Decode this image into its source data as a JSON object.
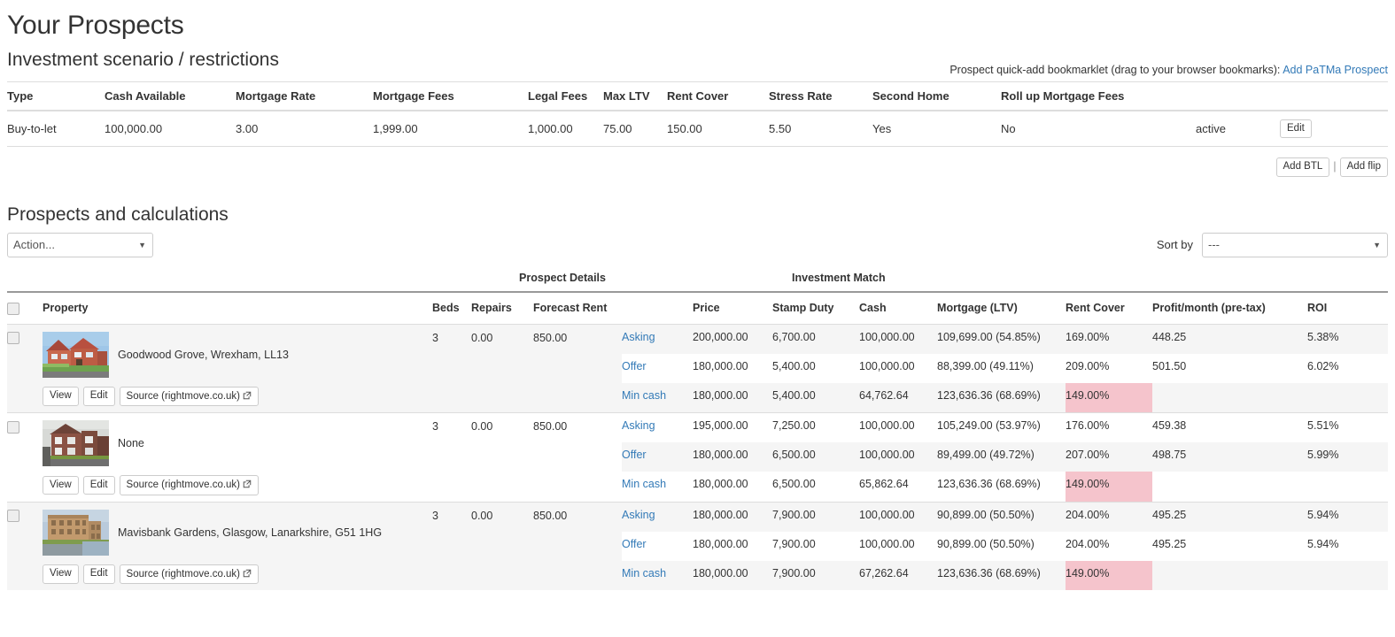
{
  "page": {
    "title": "Your Prospects",
    "scenario_heading": "Investment scenario / restrictions",
    "prospects_heading": "Prospects and calculations"
  },
  "bookmarklet": {
    "text": "Prospect quick-add bookmarklet (drag to your browser bookmarks):",
    "link_label": "Add PaTMa Prospect"
  },
  "scenario": {
    "headers": [
      "Type",
      "Cash Available",
      "Mortgage Rate",
      "Mortgage Fees",
      "Legal Fees",
      "Max LTV",
      "Rent Cover",
      "Stress Rate",
      "Second Home",
      "Roll up Mortgage Fees",
      "",
      ""
    ],
    "row": {
      "type": "Buy-to-let",
      "cash_available": "100,000.00",
      "mortgage_rate": "3.00",
      "mortgage_fees": "1,999.00",
      "legal_fees": "1,000.00",
      "max_ltv": "75.00",
      "rent_cover": "150.00",
      "stress_rate": "5.50",
      "second_home": "Yes",
      "roll_up_mortgage_fees": "No",
      "status": "active",
      "edit_label": "Edit"
    },
    "add_btl_label": "Add BTL",
    "separator": "|",
    "add_flip_label": "Add flip"
  },
  "controls": {
    "action_value": "Action...",
    "action_options": [
      "Action..."
    ],
    "sort_by_label": "Sort by",
    "sort_value": "---",
    "sort_options": [
      "---"
    ]
  },
  "grid": {
    "group_headers": {
      "prospect_details": "Prospect Details",
      "investment_match": "Investment Match"
    },
    "columns": {
      "property": "Property",
      "beds": "Beds",
      "repairs": "Repairs",
      "forecast_rent": "Forecast Rent",
      "scenario": "",
      "price": "Price",
      "stamp_duty": "Stamp Duty",
      "cash": "Cash",
      "mortgage_ltv": "Mortgage (LTV)",
      "rent_cover": "Rent Cover",
      "profit_month": "Profit/month (pre-tax)",
      "roi": "ROI"
    },
    "buttons": {
      "view": "View",
      "edit": "Edit",
      "source": "Source (rightmove.co.uk)"
    },
    "rows": [
      {
        "name": "Goodwood Grove, Wrexham, LL13",
        "thumb": "red-brick-detached-house",
        "beds": "3",
        "repairs": "0.00",
        "forecast_rent": "850.00",
        "calcs": [
          {
            "scenario": "Asking",
            "price": "200,000.00",
            "stamp_duty": "6,700.00",
            "cash": "100,000.00",
            "mortgage_ltv": "109,699.00 (54.85%)",
            "rent_cover": "169.00%",
            "rent_cover_fail": false,
            "profit_month": "448.25",
            "roi": "5.38%",
            "shaded": true
          },
          {
            "scenario": "Offer",
            "price": "180,000.00",
            "stamp_duty": "5,400.00",
            "cash": "100,000.00",
            "mortgage_ltv": "88,399.00 (49.11%)",
            "rent_cover": "209.00%",
            "rent_cover_fail": false,
            "profit_month": "501.50",
            "roi": "6.02%",
            "shaded": false
          },
          {
            "scenario": "Min cash",
            "price": "180,000.00",
            "stamp_duty": "5,400.00",
            "cash": "64,762.64",
            "mortgage_ltv": "123,636.36 (68.69%)",
            "rent_cover": "149.00%",
            "rent_cover_fail": true,
            "profit_month": "",
            "roi": "",
            "shaded": true
          }
        ]
      },
      {
        "name": "None",
        "thumb": "brick-terraced-house",
        "beds": "3",
        "repairs": "0.00",
        "forecast_rent": "850.00",
        "calcs": [
          {
            "scenario": "Asking",
            "price": "195,000.00",
            "stamp_duty": "7,250.00",
            "cash": "100,000.00",
            "mortgage_ltv": "105,249.00 (53.97%)",
            "rent_cover": "176.00%",
            "rent_cover_fail": false,
            "profit_month": "459.38",
            "roi": "5.51%",
            "shaded": false
          },
          {
            "scenario": "Offer",
            "price": "180,000.00",
            "stamp_duty": "6,500.00",
            "cash": "100,000.00",
            "mortgage_ltv": "89,499.00 (49.72%)",
            "rent_cover": "207.00%",
            "rent_cover_fail": false,
            "profit_month": "498.75",
            "roi": "5.99%",
            "shaded": true
          },
          {
            "scenario": "Min cash",
            "price": "180,000.00",
            "stamp_duty": "6,500.00",
            "cash": "65,862.64",
            "mortgage_ltv": "123,636.36 (68.69%)",
            "rent_cover": "149.00%",
            "rent_cover_fail": true,
            "profit_month": "",
            "roi": "",
            "shaded": false
          }
        ]
      },
      {
        "name": "Mavisbank Gardens, Glasgow, Lanarkshire, G51 1HG",
        "thumb": "sandstone-tenement-block",
        "beds": "3",
        "repairs": "0.00",
        "forecast_rent": "850.00",
        "calcs": [
          {
            "scenario": "Asking",
            "price": "180,000.00",
            "stamp_duty": "7,900.00",
            "cash": "100,000.00",
            "mortgage_ltv": "90,899.00 (50.50%)",
            "rent_cover": "204.00%",
            "rent_cover_fail": false,
            "profit_month": "495.25",
            "roi": "5.94%",
            "shaded": true
          },
          {
            "scenario": "Offer",
            "price": "180,000.00",
            "stamp_duty": "7,900.00",
            "cash": "100,000.00",
            "mortgage_ltv": "90,899.00 (50.50%)",
            "rent_cover": "204.00%",
            "rent_cover_fail": false,
            "profit_month": "495.25",
            "roi": "5.94%",
            "shaded": false
          },
          {
            "scenario": "Min cash",
            "price": "180,000.00",
            "stamp_duty": "7,900.00",
            "cash": "67,262.64",
            "mortgage_ltv": "123,636.36 (68.69%)",
            "rent_cover": "149.00%",
            "rent_cover_fail": true,
            "profit_month": "",
            "roi": "",
            "shaded": true
          }
        ]
      }
    ]
  },
  "colors": {
    "link": "#337ab7",
    "fail_highlight": "#f5c4cc",
    "row_shade": "#f5f5f5"
  }
}
